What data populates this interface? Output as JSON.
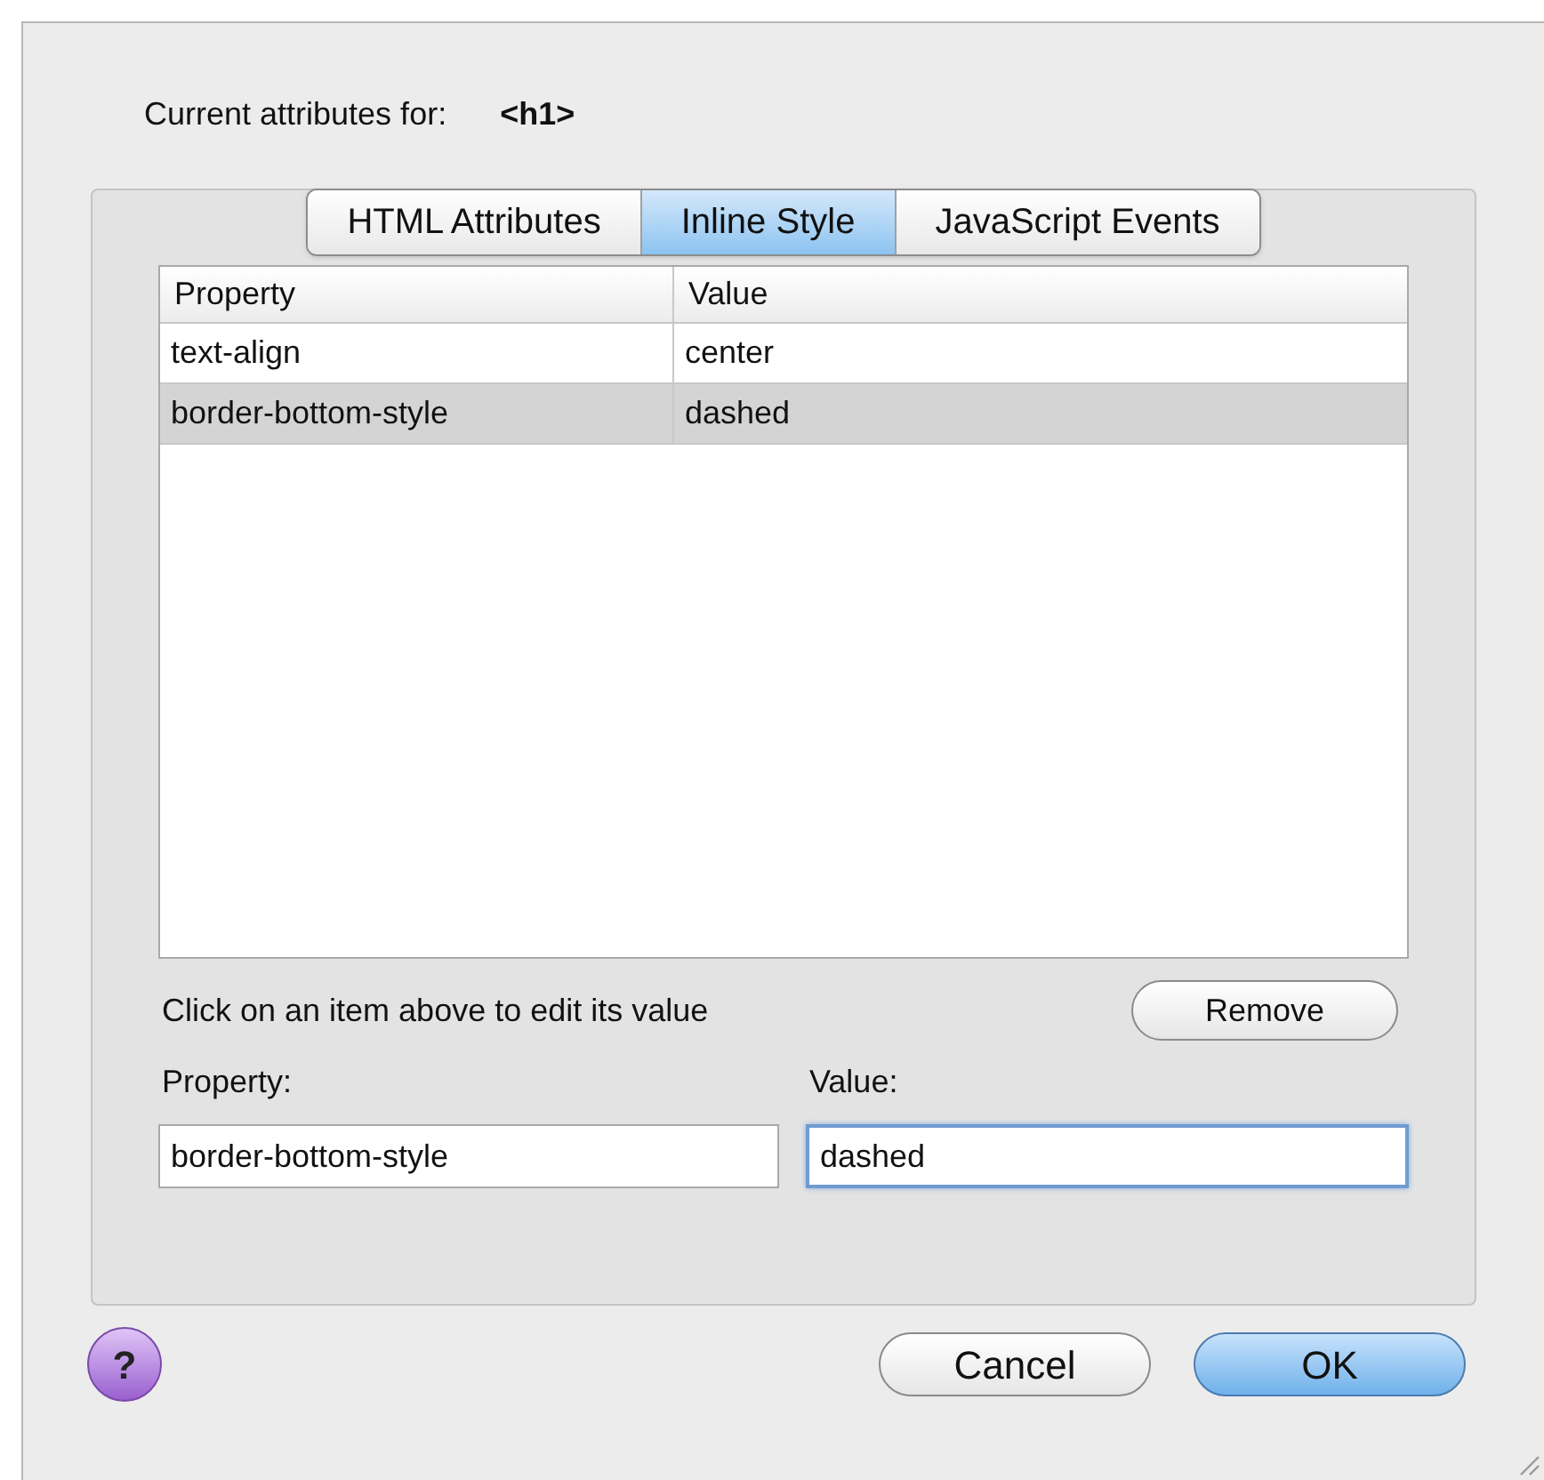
{
  "header": {
    "label": "Current attributes for:",
    "element": "<h1>"
  },
  "tabs": [
    {
      "label": "HTML Attributes",
      "selected": false
    },
    {
      "label": "Inline Style",
      "selected": true
    },
    {
      "label": "JavaScript Events",
      "selected": false
    }
  ],
  "table": {
    "columns": [
      "Property",
      "Value"
    ],
    "rows": [
      {
        "cells": [
          "text-align",
          "center"
        ],
        "selected": false
      },
      {
        "cells": [
          "border-bottom-style",
          "dashed"
        ],
        "selected": true
      }
    ]
  },
  "hint": "Click on an item above to edit its value",
  "remove_button": "Remove",
  "fields": [
    {
      "label": "Property:",
      "value": "border-bottom-style",
      "focused": false
    },
    {
      "label": "Value:",
      "value": "dashed",
      "focused": true
    }
  ],
  "help_button": "?",
  "buttons": [
    {
      "label": "Cancel",
      "kind": "normal"
    },
    {
      "label": "OK",
      "kind": "default"
    }
  ]
}
